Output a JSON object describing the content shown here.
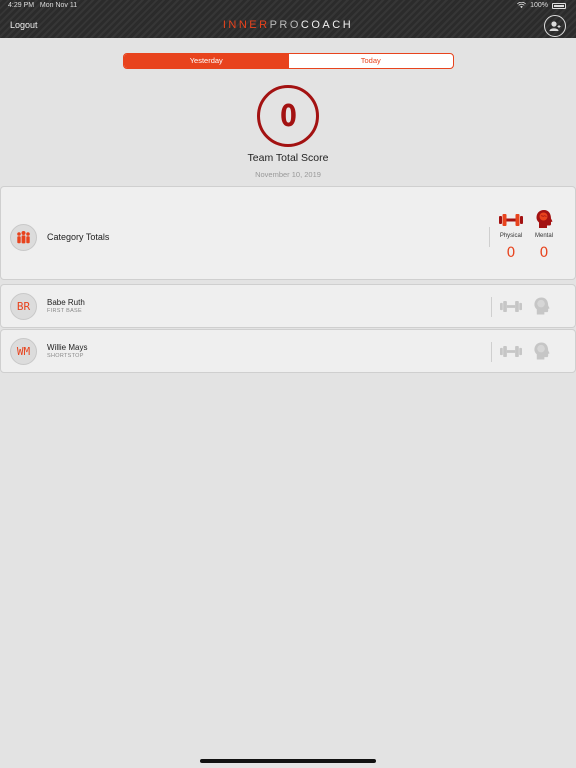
{
  "status": {
    "time": "4:29 PM",
    "date": "Mon Nov 11",
    "battery": "100%"
  },
  "header": {
    "logout_label": "Logout",
    "brand_part1": "INNER",
    "brand_part2": "PRO",
    "brand_part3": "COACH"
  },
  "tabs": [
    {
      "label": "Yesterday",
      "active": true
    },
    {
      "label": "Today",
      "active": false
    }
  ],
  "score": {
    "value": "0",
    "label": "Team Total Score",
    "date": "November 10, 2019"
  },
  "category": {
    "title": "Category Totals",
    "physical_label": "Physical",
    "physical_value": "0",
    "mental_label": "Mental",
    "mental_value": "0"
  },
  "players": [
    {
      "initials": "BR",
      "name": "Babe Ruth",
      "position": "FIRST BASE"
    },
    {
      "initials": "WM",
      "name": "Willie Mays",
      "position": "SHORTSTOP"
    }
  ],
  "colors": {
    "accent": "#e8431d",
    "score": "#a31212",
    "topbar": "#2b2b2b"
  }
}
